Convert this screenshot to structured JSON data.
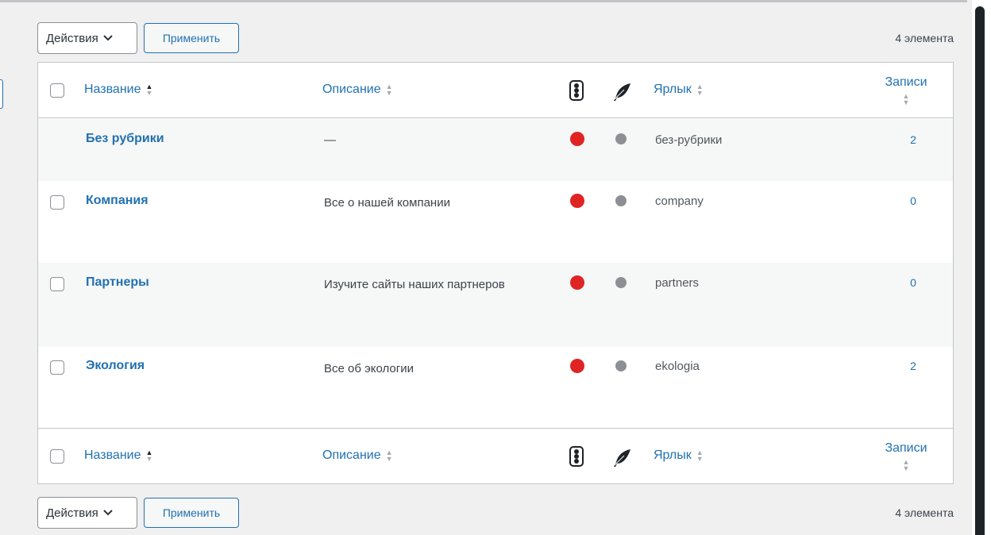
{
  "bulk_top": {
    "actions_label": "Действия",
    "apply_label": "Применить",
    "count": "4 элемента"
  },
  "bulk_bottom": {
    "actions_label": "Действия",
    "apply_label": "Применить",
    "count": "4 элемента"
  },
  "columns": {
    "name": "Название",
    "description": "Описание",
    "slug": "Ярлык",
    "posts": "Записи"
  },
  "icons": {
    "status_icon": "traffic-light-icon",
    "feather_icon": "feather-icon",
    "sort_icon": "sort-arrows-icon",
    "chevron": "chevron-down-icon"
  },
  "colors": {
    "accent": "#2271b1",
    "status_red": "#e02424",
    "status_grey": "#8c8f94"
  },
  "rows": [
    {
      "name": "Без рубрики",
      "description": "—",
      "slug": "без-рубрики",
      "posts": "2"
    },
    {
      "name": "Компания",
      "description": "Все о нашей компании",
      "slug": "company",
      "posts": "0"
    },
    {
      "name": "Партнеры",
      "description": "Изучите сайты наших партнеров",
      "slug": "partners",
      "posts": "0"
    },
    {
      "name": "Экология",
      "description": "Все об экологии",
      "slug": "ekologia",
      "posts": "2"
    }
  ]
}
